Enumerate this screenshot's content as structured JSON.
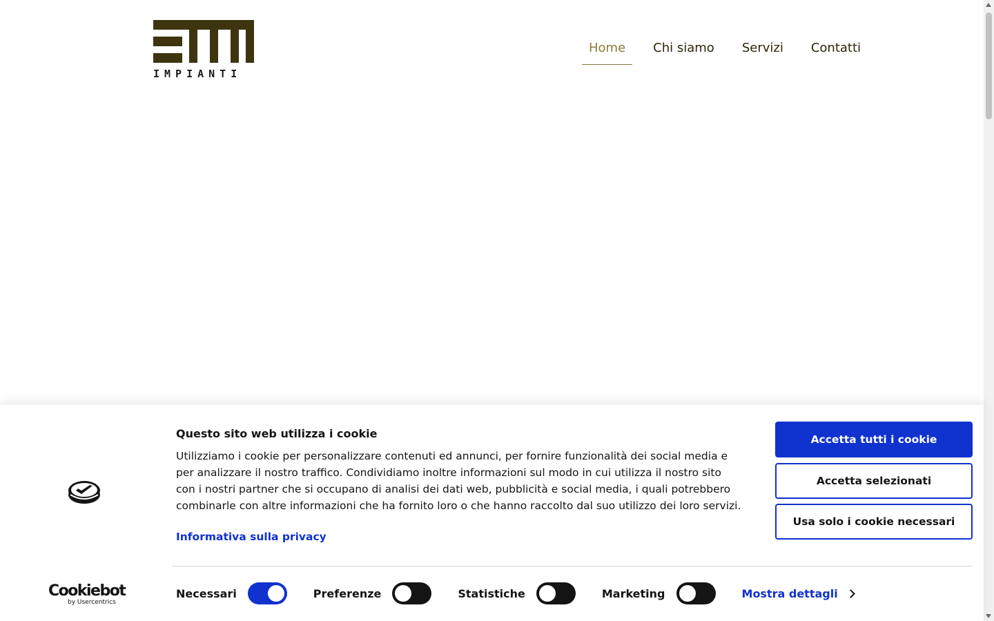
{
  "header": {
    "logo_text": "IMPIANTI",
    "nav": [
      {
        "label": "Home",
        "active": true
      },
      {
        "label": "Chi siamo",
        "active": false
      },
      {
        "label": "Servizi",
        "active": false
      },
      {
        "label": "Contatti",
        "active": false
      }
    ]
  },
  "cookie_banner": {
    "brand": {
      "name": "Cookiebot",
      "by": "by Usercentrics",
      "icon": "cookiebot-logo-icon"
    },
    "title": "Questo sito web utilizza i cookie",
    "body": "Utilizziamo i cookie per personalizzare contenuti ed annunci, per fornire funzionalità dei social media e per analizzare il nostro traffico. Condividiamo inoltre informazioni sul modo in cui utilizza il nostro sito con i nostri partner che si occupano di analisi dei dati web, pubblicità e social media, i quali potrebbero combinarle con altre informazioni che ha fornito loro o che hanno raccolto dal suo utilizzo dei loro servizi.",
    "privacy_link": "Informativa sulla privacy",
    "buttons": {
      "accept_all": "Accetta tutti i cookie",
      "accept_selected": "Accetta selezionati",
      "necessary_only": "Usa solo i cookie necessari"
    },
    "toggles": [
      {
        "label": "Necessari",
        "on": true
      },
      {
        "label": "Preferenze",
        "on": false
      },
      {
        "label": "Statistiche",
        "on": false
      },
      {
        "label": "Marketing",
        "on": false
      }
    ],
    "details_link": "Mostra dettagli"
  },
  "colors": {
    "brand_olive": "#3e340f",
    "nav_active": "#8a7a3a",
    "cookiebot_blue": "#1032cf"
  }
}
